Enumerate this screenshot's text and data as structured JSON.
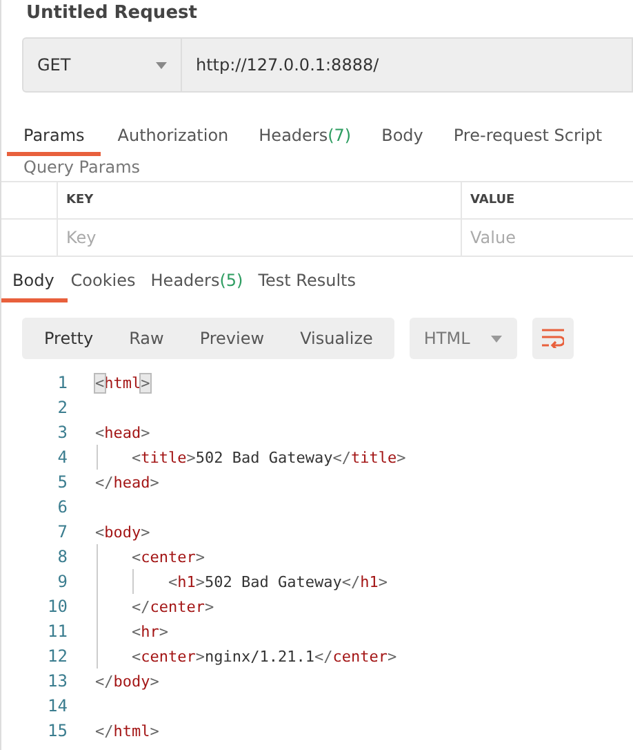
{
  "title": "Untitled Request",
  "request": {
    "method": "GET",
    "url": "http://127.0.0.1:8888/"
  },
  "request_tabs": [
    {
      "label": "Params",
      "selected": true
    },
    {
      "label": "Authorization",
      "selected": false
    },
    {
      "label": "Headers",
      "count": "(7)",
      "selected": false
    },
    {
      "label": "Body",
      "selected": false
    },
    {
      "label": "Pre-request Script",
      "selected": false
    }
  ],
  "query_params": {
    "heading": "Query Params",
    "columns": [
      "KEY",
      "VALUE"
    ],
    "placeholders": [
      "Key",
      "Value"
    ]
  },
  "response_tabs": [
    {
      "label": "Body",
      "selected": true
    },
    {
      "label": "Cookies",
      "selected": false
    },
    {
      "label": "Headers",
      "count": "(5)",
      "selected": false
    },
    {
      "label": "Test Results",
      "selected": false
    }
  ],
  "view_modes": [
    {
      "label": "Pretty",
      "selected": true
    },
    {
      "label": "Raw",
      "selected": false
    },
    {
      "label": "Preview",
      "selected": false
    },
    {
      "label": "Visualize",
      "selected": false
    }
  ],
  "format": "HTML",
  "code": [
    {
      "number": "1",
      "parts": [
        {
          "kind": "match",
          "text": "<"
        },
        {
          "kind": "tag",
          "text": "html"
        },
        {
          "kind": "match",
          "text": ">"
        }
      ]
    },
    {
      "number": "2"
    },
    {
      "number": "3",
      "parts": [
        {
          "kind": "punct",
          "text": "<"
        },
        {
          "kind": "tag",
          "text": "head"
        },
        {
          "kind": "punct",
          "text": ">"
        }
      ]
    },
    {
      "number": "4",
      "parts": [
        {
          "kind": "punct",
          "text": "    <"
        },
        {
          "kind": "tag",
          "text": "title"
        },
        {
          "kind": "punct",
          "text": ">"
        },
        {
          "kind": "text",
          "text": "502 Bad Gateway"
        },
        {
          "kind": "punct",
          "text": "</"
        },
        {
          "kind": "tag",
          "text": "title"
        },
        {
          "kind": "punct",
          "text": ">"
        }
      ]
    },
    {
      "number": "5",
      "parts": [
        {
          "kind": "punct",
          "text": "</"
        },
        {
          "kind": "tag",
          "text": "head"
        },
        {
          "kind": "punct",
          "text": ">"
        }
      ]
    },
    {
      "number": "6"
    },
    {
      "number": "7",
      "parts": [
        {
          "kind": "punct",
          "text": "<"
        },
        {
          "kind": "tag",
          "text": "body"
        },
        {
          "kind": "punct",
          "text": ">"
        }
      ]
    },
    {
      "number": "8",
      "parts": [
        {
          "kind": "punct",
          "text": "    <"
        },
        {
          "kind": "tag",
          "text": "center"
        },
        {
          "kind": "punct",
          "text": ">"
        }
      ]
    },
    {
      "number": "9",
      "parts": [
        {
          "kind": "punct",
          "text": "        <"
        },
        {
          "kind": "tag",
          "text": "h1"
        },
        {
          "kind": "punct",
          "text": ">"
        },
        {
          "kind": "text",
          "text": "502 Bad Gateway"
        },
        {
          "kind": "punct",
          "text": "</"
        },
        {
          "kind": "tag",
          "text": "h1"
        },
        {
          "kind": "punct",
          "text": ">"
        }
      ]
    },
    {
      "number": "10",
      "parts": [
        {
          "kind": "punct",
          "text": "    </"
        },
        {
          "kind": "tag",
          "text": "center"
        },
        {
          "kind": "punct",
          "text": ">"
        }
      ]
    },
    {
      "number": "11",
      "parts": [
        {
          "kind": "punct",
          "text": "    <"
        },
        {
          "kind": "tag",
          "text": "hr"
        },
        {
          "kind": "punct",
          "text": ">"
        }
      ]
    },
    {
      "number": "12",
      "parts": [
        {
          "kind": "punct",
          "text": "    <"
        },
        {
          "kind": "tag",
          "text": "center"
        },
        {
          "kind": "punct",
          "text": ">"
        },
        {
          "kind": "text",
          "text": "nginx/1.21.1"
        },
        {
          "kind": "punct",
          "text": "</"
        },
        {
          "kind": "tag",
          "text": "center"
        },
        {
          "kind": "punct",
          "text": ">"
        }
      ]
    },
    {
      "number": "13",
      "parts": [
        {
          "kind": "punct",
          "text": "</"
        },
        {
          "kind": "tag",
          "text": "body"
        },
        {
          "kind": "punct",
          "text": ">"
        }
      ]
    },
    {
      "number": "14"
    },
    {
      "number": "15",
      "parts": [
        {
          "kind": "punct",
          "text": "</"
        },
        {
          "kind": "tag",
          "text": "html"
        },
        {
          "kind": "punct",
          "text": ">"
        }
      ]
    }
  ]
}
